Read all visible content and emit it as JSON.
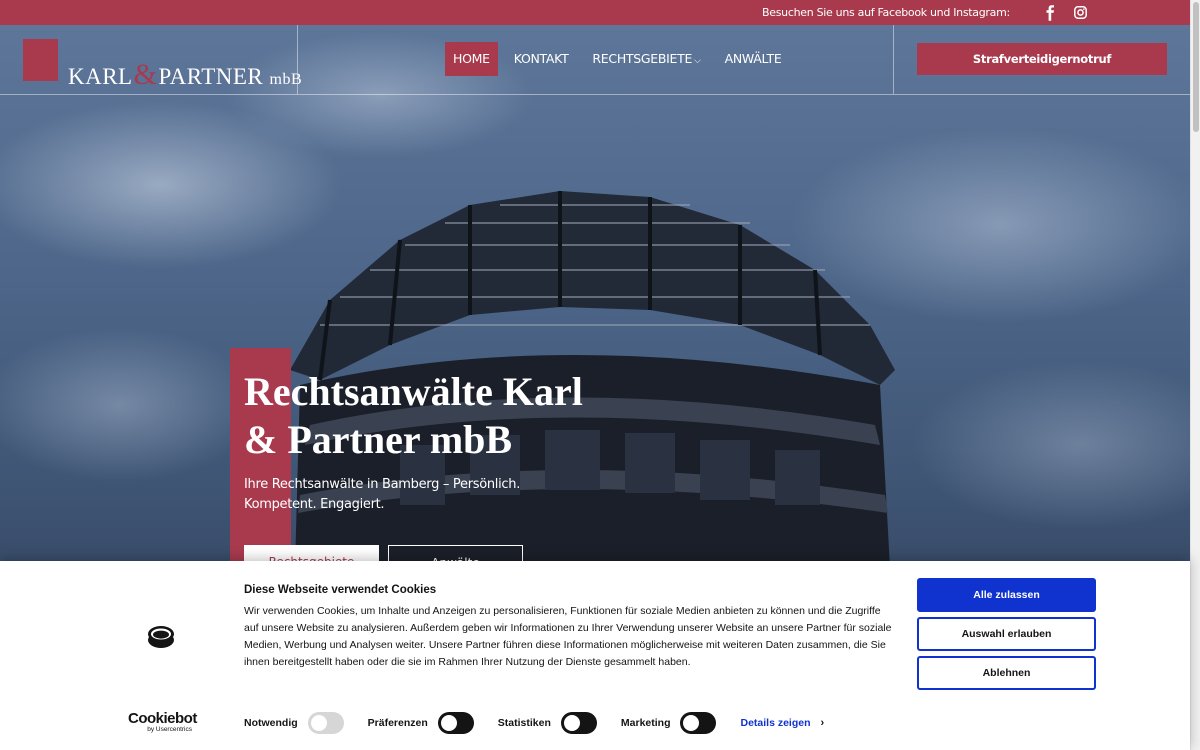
{
  "topbar": {
    "social_text": "Besuchen Sie uns auf Facebook und Instagram:",
    "icons": [
      "facebook-icon",
      "instagram-icon"
    ]
  },
  "logo": {
    "name_left": "KARL",
    "ampersand": "&",
    "name_right": "PARTNER",
    "suffix": "mbB"
  },
  "nav": {
    "items": [
      {
        "label": "HOME",
        "active": true
      },
      {
        "label": "KONTAKT",
        "active": false
      },
      {
        "label": "RECHTSGEBIETE",
        "active": false
      },
      {
        "label": "ANWÄLTE",
        "active": false
      }
    ]
  },
  "header": {
    "emergency_label": "Strafverteidigernotruf"
  },
  "hero": {
    "title_line1": "Rechtsanwälte Karl",
    "title_line2": "& Partner mbB",
    "subtitle": "Ihre Rechtsanwälte in Bamberg – Persönlich. Kompetent. Engagiert.",
    "button1": "Rechtsgebiete",
    "button2": "Anwälte"
  },
  "cookie": {
    "title": "Diese Webseite verwendet Cookies",
    "text": "Wir verwenden Cookies, um Inhalte und Anzeigen zu personalisieren, Funktionen für soziale Medien anbieten zu können und die Zugriffe auf unsere Website zu analysieren. Außerdem geben wir Informationen zu Ihrer Verwendung unserer Website an unsere Partner für soziale Medien, Werbung und Analysen weiter. Unsere Partner führen diese Informationen möglicherweise mit weiteren Daten zusammen, die Sie ihnen bereitgestellt haben oder die sie im Rahmen Ihrer Nutzung der Dienste gesammelt haben.",
    "allow_all": "Alle zulassen",
    "allow_selection": "Auswahl erlauben",
    "deny": "Ablehnen",
    "brand": "Cookiebot",
    "brand_by": "by Usercentrics",
    "toggles": [
      {
        "label": "Notwendig",
        "on": false,
        "disabled": true
      },
      {
        "label": "Präferenzen",
        "on": false,
        "disabled": false
      },
      {
        "label": "Statistiken",
        "on": false,
        "disabled": false
      },
      {
        "label": "Marketing",
        "on": false,
        "disabled": false
      }
    ],
    "details_label": "Details zeigen"
  },
  "colors": {
    "brand": "#a93a4e",
    "cookie_button": "#1032cf"
  }
}
